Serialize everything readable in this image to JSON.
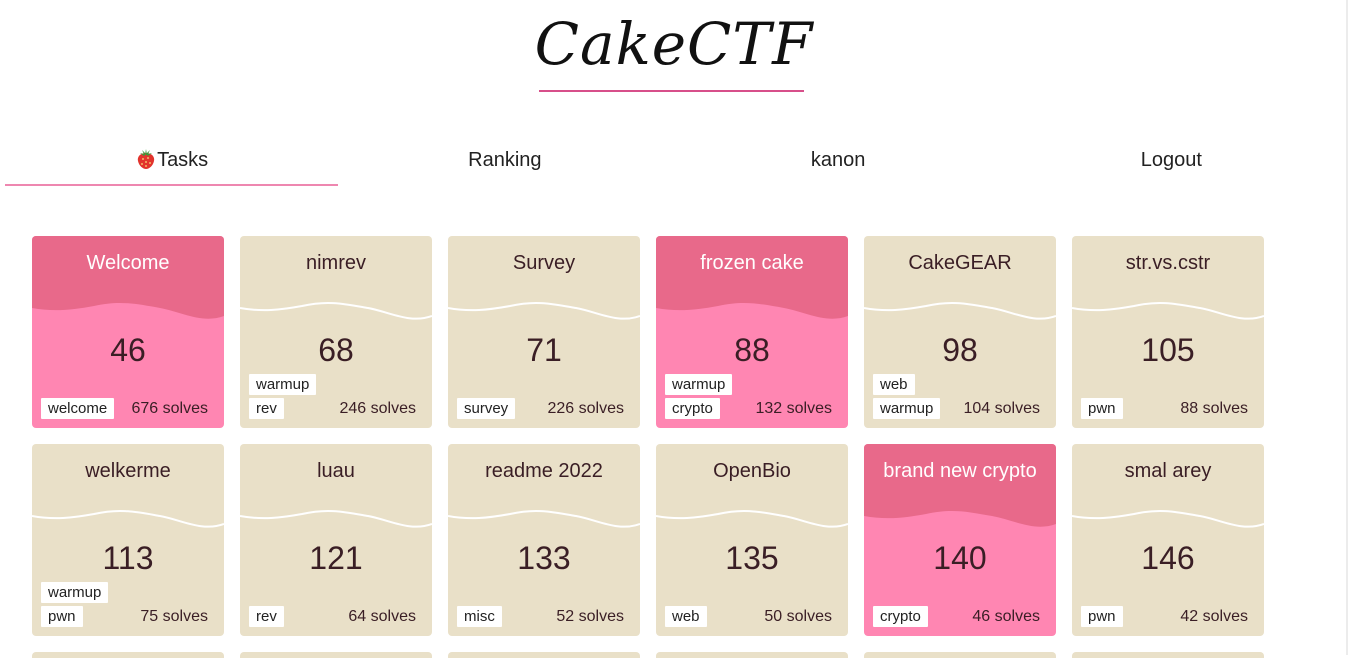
{
  "brand": {
    "logo_text": "CakeCTF"
  },
  "nav": {
    "items": [
      {
        "label": "Tasks",
        "icon": "strawberry-icon",
        "active": true
      },
      {
        "label": "Ranking",
        "active": false
      },
      {
        "label": "kanon",
        "active": false
      },
      {
        "label": "Logout",
        "active": false
      }
    ]
  },
  "colors": {
    "card_unsolved": "#e9e0c8",
    "card_solved": "#ff86b2",
    "card_solved_top": "#e8698a",
    "accent": "#d74f8a"
  },
  "tasks": [
    {
      "name": "Welcome",
      "points": "46",
      "tags": [
        "welcome"
      ],
      "solves": "676 solves",
      "solved": true
    },
    {
      "name": "nimrev",
      "points": "68",
      "tags": [
        "warmup",
        "rev"
      ],
      "solves": "246 solves",
      "solved": false
    },
    {
      "name": "Survey",
      "points": "71",
      "tags": [
        "survey"
      ],
      "solves": "226 solves",
      "solved": false
    },
    {
      "name": "frozen cake",
      "points": "88",
      "tags": [
        "warmup",
        "crypto"
      ],
      "solves": "132 solves",
      "solved": true
    },
    {
      "name": "CakeGEAR",
      "points": "98",
      "tags": [
        "web",
        "warmup"
      ],
      "solves": "104 solves",
      "solved": false
    },
    {
      "name": "str.vs.cstr",
      "points": "105",
      "tags": [
        "pwn"
      ],
      "solves": "88 solves",
      "solved": false
    },
    {
      "name": "welkerme",
      "points": "113",
      "tags": [
        "warmup",
        "pwn"
      ],
      "solves": "75 solves",
      "solved": false
    },
    {
      "name": "luau",
      "points": "121",
      "tags": [
        "rev"
      ],
      "solves": "64 solves",
      "solved": false
    },
    {
      "name": "readme 2022",
      "points": "133",
      "tags": [
        "misc"
      ],
      "solves": "52 solves",
      "solved": false
    },
    {
      "name": "OpenBio",
      "points": "135",
      "tags": [
        "web"
      ],
      "solves": "50 solves",
      "solved": false
    },
    {
      "name": "brand new crypto",
      "points": "140",
      "tags": [
        "crypto"
      ],
      "solves": "46 solves",
      "solved": true
    },
    {
      "name": "smal arey",
      "points": "146",
      "tags": [
        "pwn"
      ],
      "solves": "42 solves",
      "solved": false
    }
  ]
}
